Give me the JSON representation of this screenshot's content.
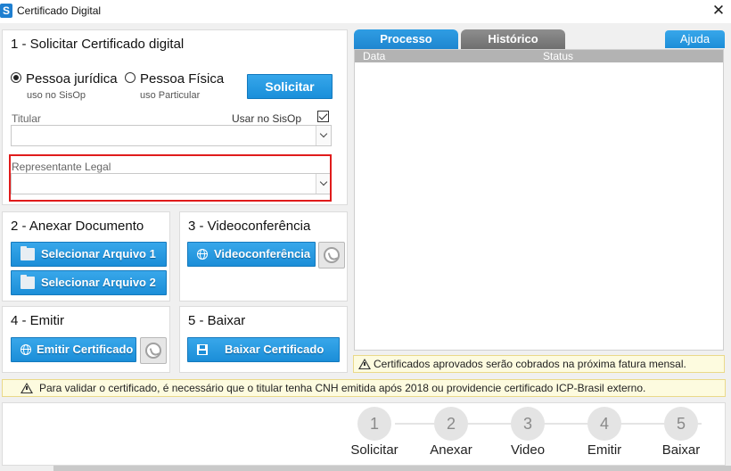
{
  "window": {
    "title": "Certificado Digital",
    "logo": "S",
    "close": "✕"
  },
  "section1": {
    "title": "1 - Solicitar Certificado digital",
    "radio_juridica": {
      "label": "Pessoa jurídica",
      "sub": "uso no SisOp",
      "selected": true
    },
    "radio_fisica": {
      "label": "Pessoa Física",
      "sub": "uso Particular",
      "selected": false
    },
    "solicitar_label": "Solicitar",
    "titular_label": "Titular",
    "usar_sisop_label": "Usar no SisOp",
    "usar_sisop_checked": true,
    "titular_value": "",
    "representante_label": "Representante Legal",
    "representante_value": ""
  },
  "section2": {
    "title": "2 - Anexar Documento",
    "btn1": "Selecionar Arquivo 1",
    "btn2": "Selecionar Arquivo 2"
  },
  "section3": {
    "title": "3 - Videoconferência",
    "btn": "Videoconferência"
  },
  "section4": {
    "title": "4 - Emitir",
    "btn": "Emitir Certificado"
  },
  "section5": {
    "title": "5 - Baixar",
    "btn": "Baixar Certificado"
  },
  "tabs": {
    "processo": "Processo",
    "historico": "Histórico",
    "ajuda": "Ajuda",
    "active": "Processo"
  },
  "grid": {
    "columns": [
      "Data",
      "Status"
    ],
    "rows": []
  },
  "warnings": {
    "cobranca": "Certificados aprovados serão cobrados na próxima fatura mensal.",
    "cnh": "Para validar o certificado, é necessário que o titular tenha CNH emitida após 2018 ou providencie certificado ICP-Brasil externo."
  },
  "steps": [
    {
      "num": "1",
      "label": "Solicitar"
    },
    {
      "num": "2",
      "label": "Anexar"
    },
    {
      "num": "3",
      "label": "Video"
    },
    {
      "num": "4",
      "label": "Emitir"
    },
    {
      "num": "5",
      "label": "Baixar"
    }
  ],
  "colors": {
    "accent": "#1f8ed8",
    "highlight": "#e01b1b",
    "warning_bg": "#fdfbdf"
  }
}
